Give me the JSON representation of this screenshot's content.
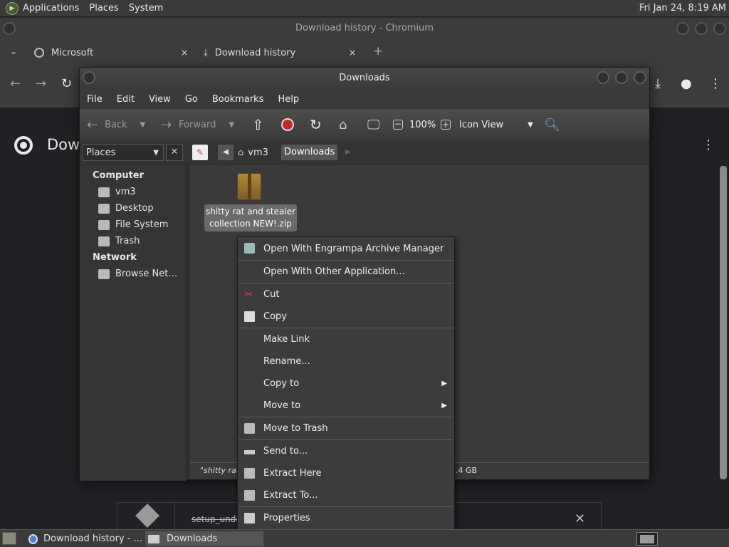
{
  "top_panel": {
    "menus": [
      "Applications",
      "Places",
      "System"
    ],
    "clock": "Fri Jan 24,  8:19 AM"
  },
  "chromium": {
    "window_title": "Download history - Chromium",
    "tabs": [
      {
        "label": "Microsoft",
        "close": "×"
      },
      {
        "label": "Download history",
        "close": "×"
      }
    ],
    "new_tab": "+",
    "page_heading": "Dow",
    "download_entry": "setup_unde"
  },
  "file_manager": {
    "title": "Downloads",
    "menubar": [
      "File",
      "Edit",
      "View",
      "Go",
      "Bookmarks",
      "Help"
    ],
    "toolbar": {
      "back": "Back",
      "forward": "Forward",
      "zoom": "100%",
      "view_mode": "Icon View"
    },
    "sidebar": {
      "selector": "Places",
      "computer_heading": "Computer",
      "computer_items": [
        "vm3",
        "Desktop",
        "File System",
        "Trash"
      ],
      "network_heading": "Network",
      "network_items": [
        "Browse Net…"
      ]
    },
    "path": [
      "vm3",
      "Downloads"
    ],
    "file": {
      "name_line1": "shitty rat and stealer",
      "name_line2": "collection NEW!.zip"
    },
    "status": {
      "left": "\"shitty rat a",
      "right": "1.4 GB"
    }
  },
  "context_menu": {
    "items": [
      {
        "label": "Open With Engrampa Archive Manager",
        "icon": "archive-icon"
      },
      {
        "label": "Open With Other Application...",
        "icon": ""
      },
      {
        "label": "Cut",
        "icon": "scissors-icon"
      },
      {
        "label": "Copy",
        "icon": "copy-icon"
      },
      {
        "label": "Make Link",
        "icon": ""
      },
      {
        "label": "Rename...",
        "icon": ""
      },
      {
        "label": "Copy to",
        "icon": ""
      },
      {
        "label": "Move to",
        "icon": ""
      },
      {
        "label": "Move to Trash",
        "icon": "trash-icon"
      },
      {
        "label": "Send to...",
        "icon": "send-icon"
      },
      {
        "label": "Extract Here",
        "icon": "extract-icon"
      },
      {
        "label": "Extract To...",
        "icon": "extract-icon"
      },
      {
        "label": "Properties",
        "icon": "properties-icon"
      }
    ]
  },
  "taskbar": {
    "tasks": [
      "Download history - ...",
      "Downloads"
    ]
  }
}
